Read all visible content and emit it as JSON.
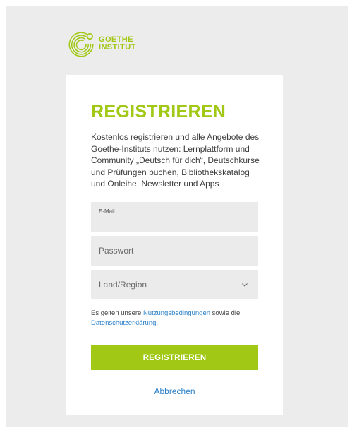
{
  "brand": {
    "logo_line1": "GOETHE",
    "logo_line2": "INSTITUT",
    "color": "#a0c814"
  },
  "form": {
    "title": "REGISTRIEREN",
    "description": "Kostenlos registrieren und alle Angebote des Goethe-Instituts nutzen: Lernplattform und Community „Deutsch für dich“, Deutschkurse und Prüfungen buchen, Bibliothekskatalog und Onleihe, Newsletter und Apps",
    "email": {
      "label": "E-Mail",
      "value": ""
    },
    "password": {
      "placeholder": "Passwort"
    },
    "country": {
      "placeholder": "Land/Region",
      "icon": "chevron-down-icon"
    },
    "terms": {
      "prefix": "Es gelten unsere ",
      "terms_link": "Nutzungsbedingungen",
      "middle": " sowie die ",
      "privacy_link": "Datenschutzerklärung",
      "suffix": "."
    },
    "submit_label": "REGISTRIEREN",
    "cancel_label": "Abbrechen"
  },
  "colors": {
    "accent": "#a0c814",
    "link": "#2a80c8",
    "field_bg": "#ebebeb",
    "page_bg": "#ececec"
  }
}
